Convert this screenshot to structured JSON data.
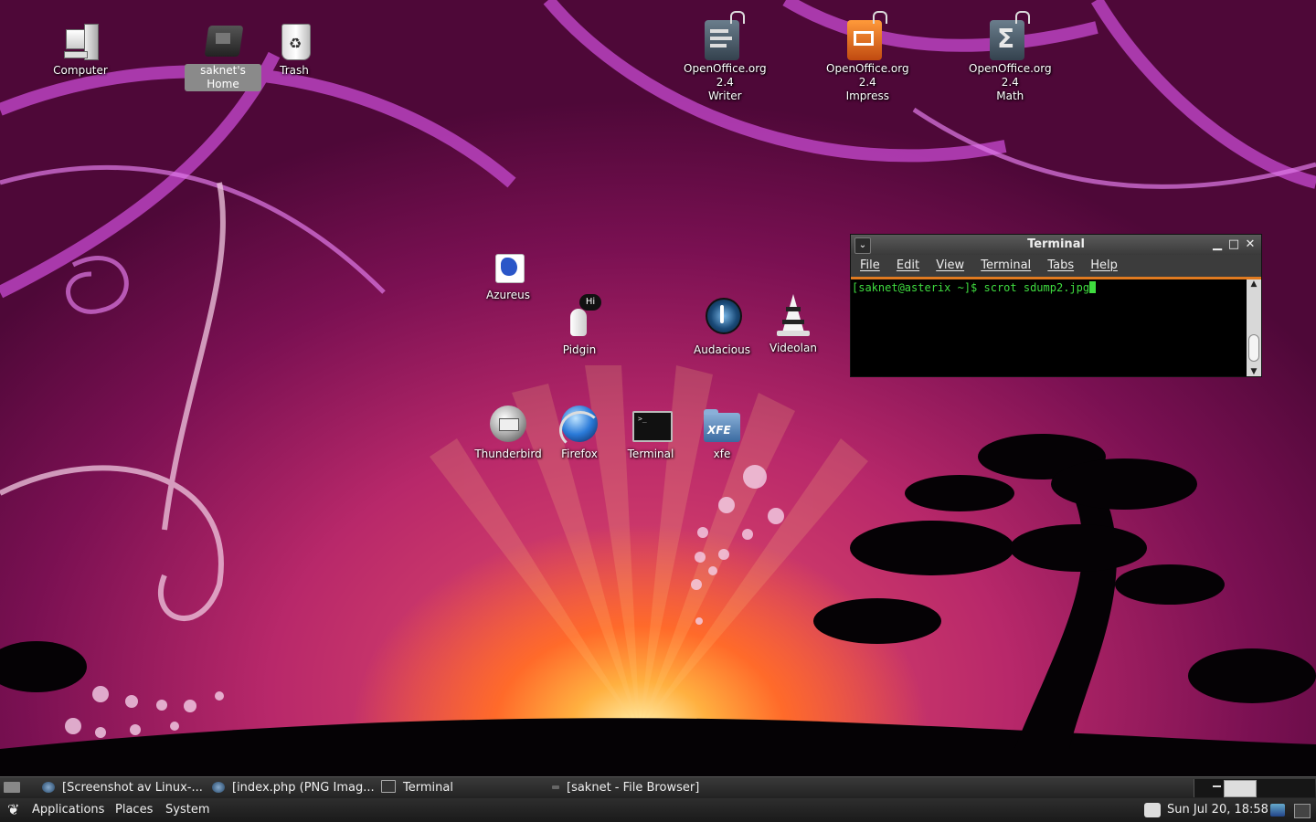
{
  "desktop": {
    "icons": [
      {
        "label": "Computer",
        "icon": "computer-icon"
      },
      {
        "label": "saknet's Home",
        "icon": "home-folder-icon"
      },
      {
        "label": "Trash",
        "icon": "trash-icon"
      },
      {
        "label": "OpenOffice.org 2.4\nWriter",
        "icon": "writer-icon"
      },
      {
        "label": "OpenOffice.org 2.4\nImpress",
        "icon": "impress-icon"
      },
      {
        "label": "OpenOffice.org 2.4\nMath",
        "icon": "math-icon"
      },
      {
        "label": "Azureus",
        "icon": "azureus-icon"
      },
      {
        "label": "Pidgin",
        "icon": "pidgin-icon"
      },
      {
        "label": "Audacious",
        "icon": "audacious-icon"
      },
      {
        "label": "Videolan",
        "icon": "vlc-icon"
      },
      {
        "label": "Thunderbird",
        "icon": "thunderbird-icon"
      },
      {
        "label": "Firefox",
        "icon": "firefox-icon"
      },
      {
        "label": "Terminal",
        "icon": "terminal-icon"
      },
      {
        "label": "xfe",
        "icon": "xfe-folder-icon"
      }
    ]
  },
  "terminal_window": {
    "title": "Terminal",
    "menu": [
      "File",
      "Edit",
      "View",
      "Terminal",
      "Tabs",
      "Help"
    ],
    "prompt": "[saknet@asterix ~]$ scrot sdump2.jpg",
    "accent": "#e07a20",
    "text_color": "#3fdc3f"
  },
  "taskbar": {
    "tasks": [
      {
        "label": "[Screenshot av Linux-..."
      },
      {
        "label": "[index.php (PNG Imag..."
      },
      {
        "label": "Terminal"
      },
      {
        "label": "[saknet - File Browser]"
      }
    ]
  },
  "bottom_panel": {
    "menus": [
      "Applications",
      "Places",
      "System"
    ],
    "clock": "Sun Jul 20, 18:58"
  }
}
